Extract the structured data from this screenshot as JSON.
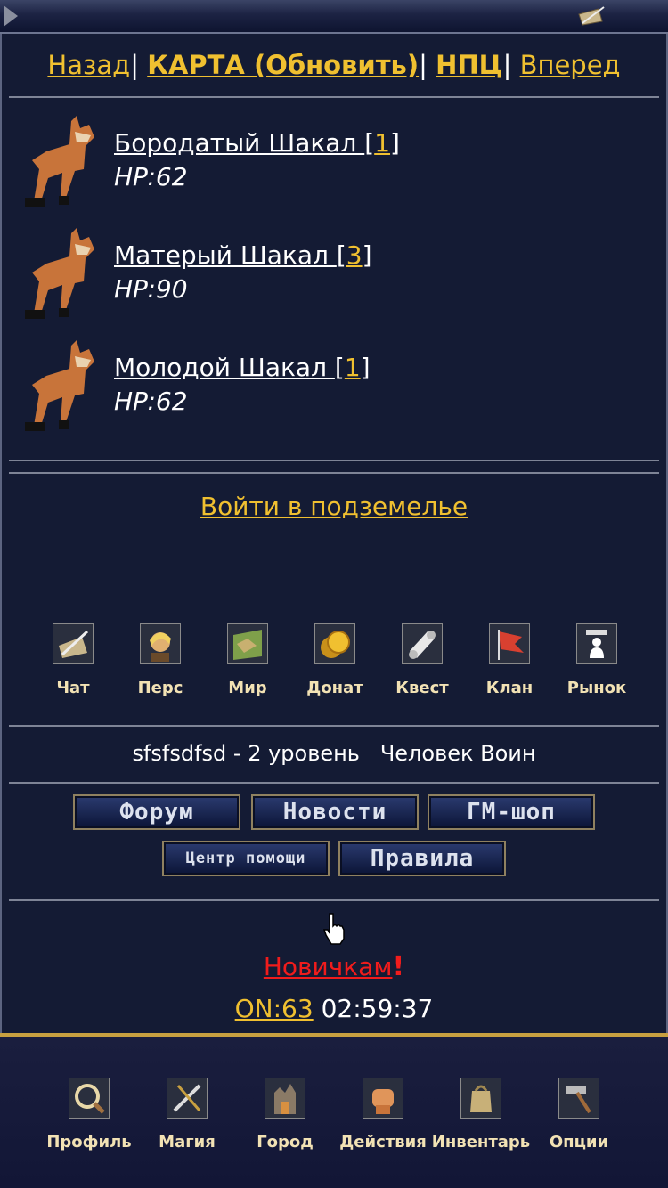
{
  "nav": {
    "back": "Назад",
    "sep1": "|",
    "map": "КАРТА (Обновить)",
    "sep2": "|",
    "npc": "НПЦ",
    "sep3": "|",
    "forward": "Вперед"
  },
  "mobs": [
    {
      "name": "Бородатый Шакал ",
      "level_open": "[",
      "level": "1",
      "level_close": "]",
      "hp": "HP:62"
    },
    {
      "name": "Матерый Шакал ",
      "level_open": "[",
      "level": "3",
      "level_close": "]",
      "hp": "HP:90"
    },
    {
      "name": "Молодой Шакал ",
      "level_open": "[",
      "level": "1",
      "level_close": "]",
      "hp": "HP:62"
    }
  ],
  "dungeon_link": "Войти в подземелье",
  "menu": [
    {
      "label": "Чат",
      "icon": "chat-quill-icon"
    },
    {
      "label": "Перс",
      "icon": "character-icon"
    },
    {
      "label": "Мир",
      "icon": "world-map-icon"
    },
    {
      "label": "Донат",
      "icon": "coins-icon"
    },
    {
      "label": "Квест",
      "icon": "scroll-icon"
    },
    {
      "label": "Клан",
      "icon": "clan-flag-icon"
    },
    {
      "label": "Рынок",
      "icon": "market-icon"
    }
  ],
  "player_info": "sfsfsdfsd - 2 уровень   Человек Воин",
  "buttons": {
    "forum": "Форум",
    "news": "Новости",
    "gm_shop": "ГМ-шоп",
    "help": "Центр помощи",
    "rules": "Правила"
  },
  "novice": {
    "link": "Новичкам",
    "mark": "!"
  },
  "online": {
    "count": "ON:63",
    "time": "02:59:37"
  },
  "bottom_nav": [
    {
      "label": "Профиль",
      "icon": "profile-icon"
    },
    {
      "label": "Магия",
      "icon": "magic-icon"
    },
    {
      "label": "Город",
      "icon": "city-icon"
    },
    {
      "label": "Действия",
      "icon": "actions-fist-icon"
    },
    {
      "label": "Инвентарь",
      "icon": "inventory-bag-icon"
    },
    {
      "label": "Опции",
      "icon": "options-hammer-icon"
    }
  ],
  "colors": {
    "link": "#f0c030",
    "alert": "#f01c1c",
    "label": "#f2e2b4",
    "bg": "#141b34"
  }
}
